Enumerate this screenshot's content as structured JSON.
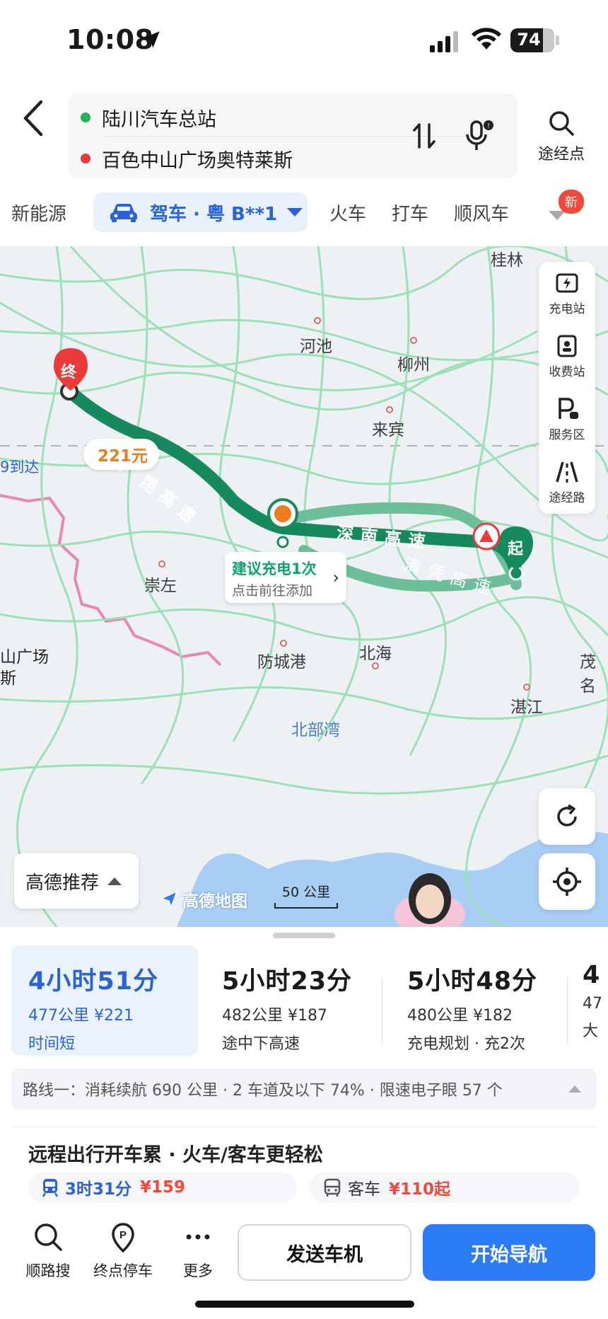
{
  "status_bar": {
    "time": "10:08",
    "battery": "74",
    "battery_level": 0.74
  },
  "header": {
    "start": "陆川汽车总站",
    "end": "百色中山广场奥特莱斯",
    "waypoint_label": "途经点"
  },
  "modes": {
    "new_energy": "新能源",
    "drive": "驾车 · 粤 B**1",
    "train": "火车",
    "taxi": "打车",
    "carpool": "顺风车",
    "new_badge": "新"
  },
  "map": {
    "cities": {
      "guilin": "桂林",
      "hechi": "河池",
      "liuzhou": "柳州",
      "laibin": "来宾",
      "chongzuo": "崇左",
      "fangchenggang": "防城港",
      "beihai": "北海",
      "zhanjiang": "湛江",
      "maoming": "茂名",
      "beibu_gulf": "北部湾"
    },
    "dest_label_line1": "山广场",
    "dest_label_line2": "斯",
    "dest_eta": "9到达",
    "dest_marker": "终",
    "start_marker": "起",
    "fee": "221元",
    "charge_title": "建议充电1次",
    "charge_sub": "点击前往添加",
    "roads": {
      "guangkun": "广昆高速",
      "shennan": "深南高速",
      "qingping": "清凭高速"
    },
    "tools": {
      "charging": "充电站",
      "toll": "收费站",
      "service": "服务区",
      "via_road": "途经路"
    },
    "recommend": "高德推荐",
    "logo": "高德地图",
    "scale": "50 公里",
    "colors": {
      "route_main": "#168a5c",
      "route_alt": "#6dbf9a",
      "road": "#9be0b6",
      "water": "#a9cef5"
    }
  },
  "routes": [
    {
      "time": "4小时51分",
      "meta": "477公里  ¥221",
      "tag": "时间短"
    },
    {
      "time": "5小时23分",
      "meta": "482公里  ¥187",
      "tag": "途中下高速"
    },
    {
      "time": "5小时48分",
      "meta": "480公里  ¥182",
      "tag": "充电规划 · 充2次"
    },
    {
      "time": "4",
      "meta": "47",
      "tag": "大"
    }
  ],
  "summary": "路线一：消耗续航 690 公里 · 2 车道及以下 74% · 限速电子眼 57 个",
  "promo": {
    "title": "远程出行开车累 · 火车/客车更轻松",
    "train_time": "3时31分",
    "train_price": "¥159",
    "bus_label": "客车",
    "bus_price": "¥110起"
  },
  "bottom": {
    "search_along": "顺路搜",
    "end_parking": "终点停车",
    "more": "更多",
    "send_to_car": "发送车机",
    "start_nav": "开始导航"
  }
}
